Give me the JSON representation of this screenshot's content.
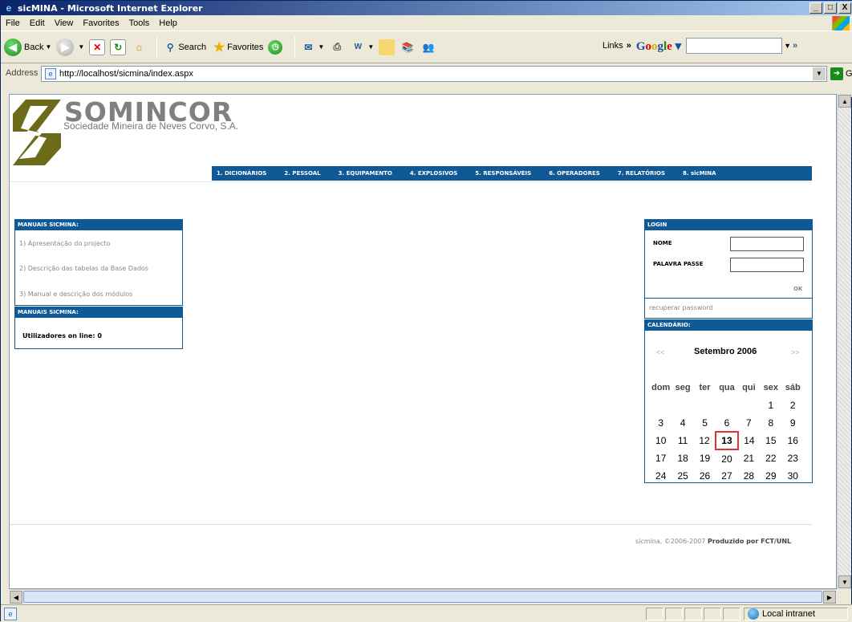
{
  "window": {
    "title": "sicMINA - Microsoft Internet Explorer",
    "controls": [
      "_",
      "□",
      "X"
    ]
  },
  "menu": [
    "File",
    "Edit",
    "View",
    "Favorites",
    "Tools",
    "Help"
  ],
  "toolbar": {
    "back": "Back",
    "search": "Search",
    "favorites": "Favorites",
    "links": "Links",
    "chevron": "»",
    "google": "Google"
  },
  "address": {
    "label": "Address",
    "url": "http://localhost/sicmina/index.aspx",
    "go": "Go"
  },
  "brand": {
    "name": "SOMINCOR",
    "subtitle": "Sociedade Mineira de Neves Corvo, S.A."
  },
  "nav": [
    "1. DICIONÁRIOS",
    "2. PESSOAL",
    "3. EQUIPAMENTO",
    "4. EXPLOSIVOS",
    "5. RESPONSÁVEIS",
    "6. OPERADORES",
    "7. RELATÓRIOS",
    "8. sicMINA"
  ],
  "manuals": {
    "header": "MANUAIS SICMINA:",
    "items": [
      "1) Apresentação do projecto",
      "2) Descrição das tabelas da Base Dados",
      "3) Manual e descrição dos módulos"
    ]
  },
  "online": {
    "header": "MANUAIS SICMINA:",
    "label": "Utilizadores on line",
    "count": "0"
  },
  "login": {
    "header": "LOGIN",
    "name_label": "NOME",
    "password_label": "PALAVRA PASSE",
    "ok": "OK",
    "recover": "recuperar password"
  },
  "calendar": {
    "header": "CALENDÁRIO:",
    "prev": "<<",
    "next": ">>",
    "month": "Setembro 2006",
    "weekdays": [
      "dom",
      "seg",
      "ter",
      "qua",
      "qui",
      "sex",
      "sáb"
    ],
    "weeks": [
      [
        "",
        "",
        "",
        "",
        "",
        "1",
        "2"
      ],
      [
        "3",
        "4",
        "5",
        "6",
        "7",
        "8",
        "9"
      ],
      [
        "10",
        "11",
        "12",
        "13",
        "14",
        "15",
        "16"
      ],
      [
        "17",
        "18",
        "19",
        "20",
        "21",
        "22",
        "23"
      ],
      [
        "24",
        "25",
        "26",
        "27",
        "28",
        "29",
        "30"
      ]
    ],
    "today": "13"
  },
  "footer": {
    "text": "sicmina, ©2006-2007",
    "credit": "Produzido por FCT/UNL"
  },
  "status": {
    "zone": "Local intranet"
  }
}
